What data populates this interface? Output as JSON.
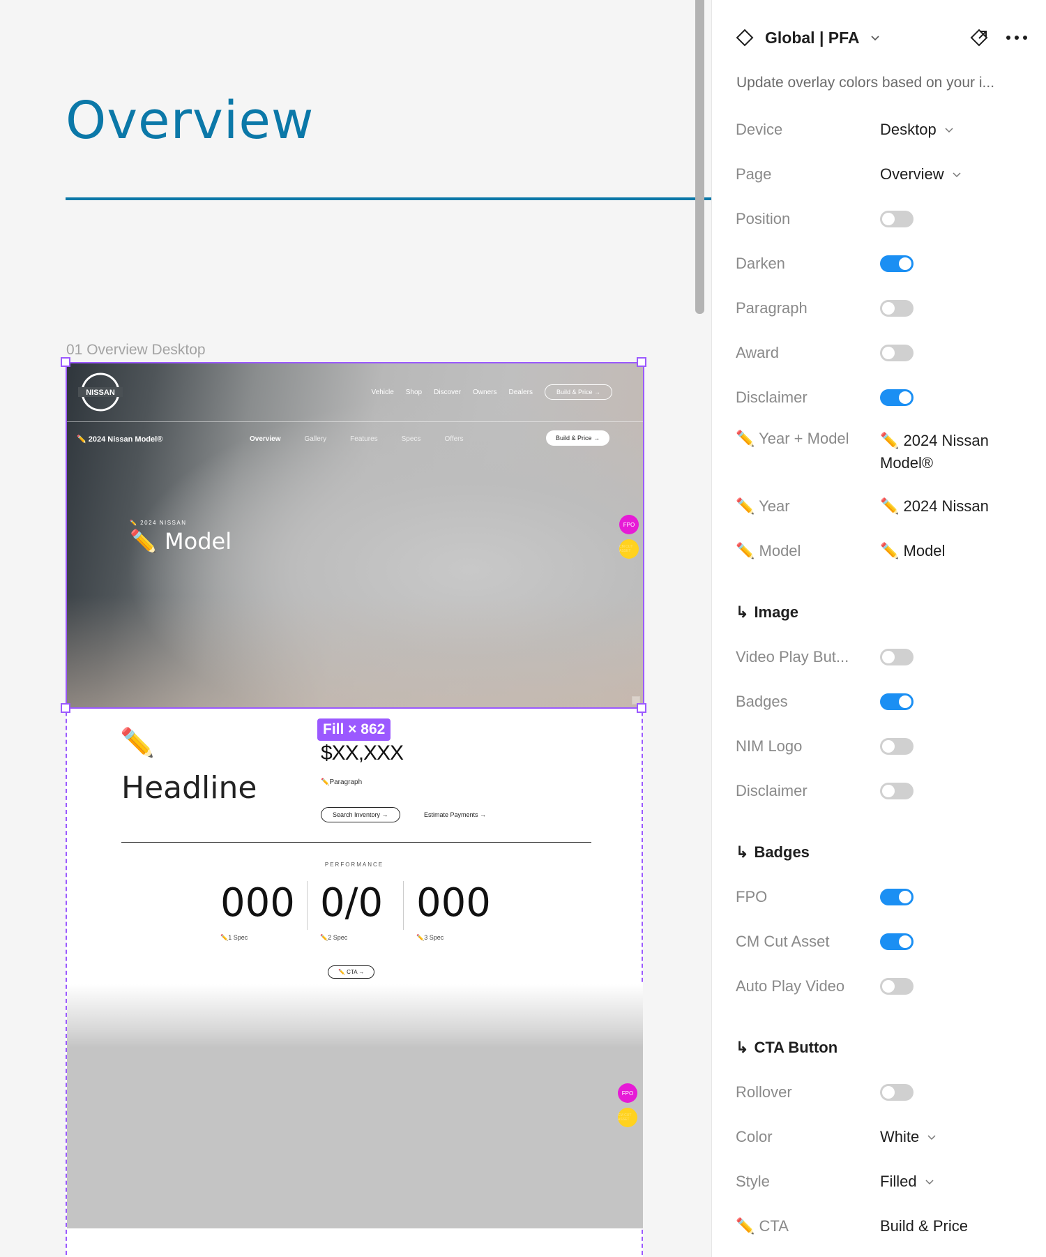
{
  "canvas": {
    "page_heading": "Overview",
    "frame_label": "01 Overview Desktop",
    "fill_tag": "Fill × 862"
  },
  "site": {
    "logo_text": "NISSAN",
    "nav": [
      "Vehicle",
      "Shop",
      "Discover",
      "Owners",
      "Dealers"
    ],
    "nav_cta": "Build & Price",
    "subnav_brand": "✏️ 2024 Nissan Model®",
    "subnav_tabs": [
      "Overview",
      "Gallery",
      "Features",
      "Specs",
      "Offers"
    ],
    "subnav_cta": "Build & Price",
    "hero_eyebrow": "✏️ 2024 NISSAN",
    "hero_model": "✏️ Model",
    "badge_fpo": "FPO",
    "badge_cm": "CM CUT ASSET",
    "pencil": "✏️",
    "headline": "Headline",
    "price": "$XX,XXX",
    "paragraph": "✏️Paragraph",
    "search_btn": "Search Inventory",
    "estimate_btn": "Estimate Payments",
    "performance_label": "PERFORMANCE",
    "specs": [
      {
        "value": "000",
        "label": "✏️1 Spec"
      },
      {
        "value": "0/0",
        "label": "✏️2 Spec"
      },
      {
        "value": "000",
        "label": "✏️3 Spec"
      }
    ],
    "cta": "✏️ CTA"
  },
  "panel": {
    "title": "Global | PFA",
    "description": "Update overlay colors based on your i...",
    "rows": [
      {
        "label": "Device",
        "type": "select",
        "value": "Desktop"
      },
      {
        "label": "Page",
        "type": "select",
        "value": "Overview"
      },
      {
        "label": "Position",
        "type": "toggle",
        "value": "off"
      },
      {
        "label": "Darken",
        "type": "toggle",
        "value": "on"
      },
      {
        "label": "Paragraph",
        "type": "toggle",
        "value": "off"
      },
      {
        "label": "Award",
        "type": "toggle",
        "value": "off"
      },
      {
        "label": "Disclaimer",
        "type": "toggle",
        "value": "on"
      },
      {
        "label": "✏️ Year + Model",
        "type": "text",
        "value": "✏️ 2024 Nissan Model®"
      },
      {
        "label": "✏️ Year",
        "type": "text",
        "value": "✏️ 2024 Nissan"
      },
      {
        "label": "✏️ Model",
        "type": "text",
        "value": "✏️ Model"
      }
    ],
    "section_image": "Image",
    "image_rows": [
      {
        "label": "Video Play But...",
        "value": "off"
      },
      {
        "label": "Badges",
        "value": "on"
      },
      {
        "label": "NIM Logo",
        "value": "off"
      },
      {
        "label": "Disclaimer",
        "value": "off"
      }
    ],
    "section_badges": "Badges",
    "badge_rows": [
      {
        "label": "FPO",
        "value": "on"
      },
      {
        "label": "CM Cut Asset",
        "value": "on"
      },
      {
        "label": "Auto Play Video",
        "value": "off"
      }
    ],
    "section_cta": "CTA Button",
    "cta_rows": [
      {
        "label": "Rollover",
        "type": "toggle",
        "value": "off"
      },
      {
        "label": "Color",
        "type": "select",
        "value": "White"
      },
      {
        "label": "Style",
        "type": "select",
        "value": "Filled"
      },
      {
        "label": "✏️ CTA",
        "type": "text",
        "value": "Build & Price"
      }
    ]
  },
  "colors": {
    "accent_blue": "#0b78a8",
    "selection_purple": "#9b59ff",
    "toggle_on": "#1b8ff3",
    "badge_fpo": "#e61bd6",
    "badge_cm": "#ffd21f"
  }
}
